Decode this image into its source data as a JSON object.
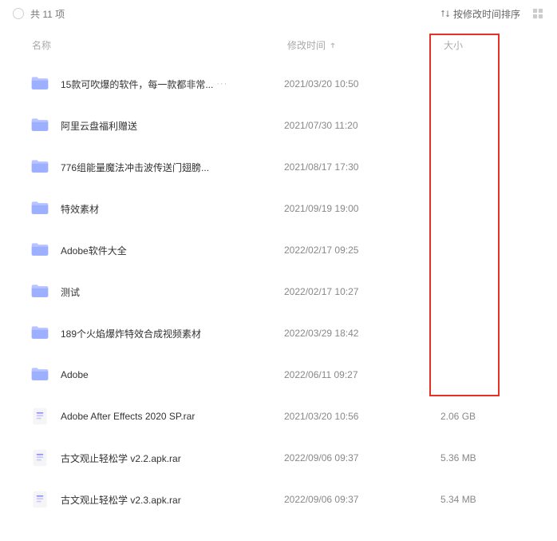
{
  "topbar": {
    "count_text": "共 11 项",
    "sort_label": "按修改时间排序"
  },
  "columns": {
    "name": "名称",
    "mtime": "修改时间",
    "size": "大小"
  },
  "items": [
    {
      "type": "folder",
      "name": "15款可吹爆的软件，每一款都非常...",
      "mtime": "2021/03/20 10:50",
      "size": "",
      "truncated": true
    },
    {
      "type": "folder",
      "name": "阿里云盘福利赠送",
      "mtime": "2021/07/30 11:20",
      "size": "",
      "truncated": false
    },
    {
      "type": "folder",
      "name": "776组能量魔法冲击波传送门翅膀...",
      "mtime": "2021/08/17 17:30",
      "size": "",
      "truncated": false
    },
    {
      "type": "folder",
      "name": "特效素材",
      "mtime": "2021/09/19 19:00",
      "size": "",
      "truncated": false
    },
    {
      "type": "folder",
      "name": "Adobe软件大全",
      "mtime": "2022/02/17 09:25",
      "size": "",
      "truncated": false
    },
    {
      "type": "folder",
      "name": "测试",
      "mtime": "2022/02/17 10:27",
      "size": "",
      "truncated": false
    },
    {
      "type": "folder",
      "name": "189个火焰爆炸特效合成视频素材",
      "mtime": "2022/03/29 18:42",
      "size": "",
      "truncated": false
    },
    {
      "type": "folder",
      "name": "Adobe",
      "mtime": "2022/06/11 09:27",
      "size": "",
      "truncated": false
    },
    {
      "type": "file",
      "name": "Adobe After Effects 2020 SP.rar",
      "mtime": "2021/03/20 10:56",
      "size": "2.06 GB",
      "truncated": false
    },
    {
      "type": "file",
      "name": "古文观止轻松学 v2.2.apk.rar",
      "mtime": "2022/09/06 09:37",
      "size": "5.36 MB",
      "truncated": false
    },
    {
      "type": "file",
      "name": "古文观止轻松学 v2.3.apk.rar",
      "mtime": "2022/09/06 09:37",
      "size": "5.34 MB",
      "truncated": false
    }
  ]
}
